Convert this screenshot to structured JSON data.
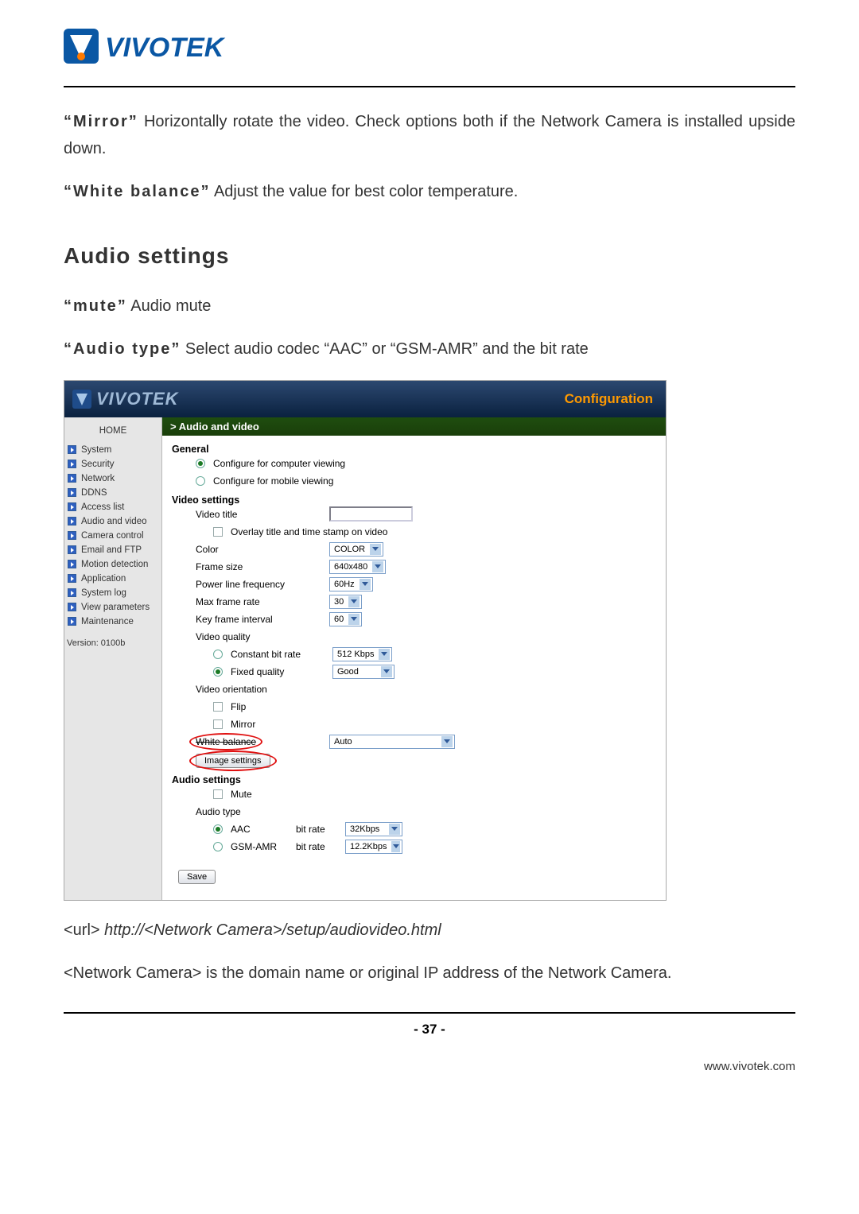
{
  "brand": "VIVOTEK",
  "body": {
    "mirror_label": "“Mirror”",
    "mirror_text": "Horizontally rotate the video. Check options both if the Network Camera is installed upside down.",
    "wb_label": "“White balance”",
    "wb_text": "Adjust the value for best color temperature.",
    "audio_heading": "Audio settings",
    "mute_label": "“mute”",
    "mute_text": "Audio mute",
    "atype_label": "“Audio type”",
    "atype_text": "Select audio codec “AAC” or “GSM-AMR” and the bit rate",
    "url_prefix": "<url>",
    "url_value": "http://<Network Camera>/setup/audiovideo.html",
    "note_text": "<Network Camera> is the domain name or original IP address of the Network Camera."
  },
  "cap": {
    "brand": "VIVOTEK",
    "config_label": "Configuration",
    "panel_title": "> Audio and video",
    "sidebar": {
      "home": "HOME",
      "items": [
        "System",
        "Security",
        "Network",
        "DDNS",
        "Access list",
        "Audio and video",
        "Camera control",
        "Email and FTP",
        "Motion detection",
        "Application",
        "System log",
        "View parameters",
        "Maintenance"
      ],
      "version": "Version: 0100b"
    },
    "groups": {
      "general": "General",
      "cfg_computer": "Configure for computer viewing",
      "cfg_mobile": "Configure for mobile viewing",
      "video_settings": "Video settings",
      "video_title": "Video title",
      "overlay": "Overlay title and time stamp on video",
      "color_label": "Color",
      "color_value": "COLOR",
      "frame_size_label": "Frame size",
      "frame_size_value": "640x480",
      "plf_label": "Power line frequency",
      "plf_value": "60Hz",
      "maxfr_label": "Max frame rate",
      "maxfr_value": "30",
      "kfi_label": "Key frame interval",
      "kfi_value": "60",
      "vq_label": "Video quality",
      "cbr_label": "Constant bit rate",
      "cbr_value": "512 Kbps",
      "fq_label": "Fixed quality",
      "fq_value": "Good",
      "vo_label": "Video orientation",
      "flip": "Flip",
      "mirror": "Mirror",
      "wb_label": "White balance",
      "wb_value": "Auto",
      "img_settings": "Image settings",
      "audio_settings": "Audio settings",
      "mute": "Mute",
      "audio_type": "Audio type",
      "aac": "AAC",
      "bitrate": "bit rate",
      "aac_bitrate": "32Kbps",
      "gsm": "GSM-AMR",
      "gsm_bitrate": "12.2Kbps",
      "save": "Save"
    }
  },
  "footer": {
    "page": "- 37 -",
    "url": "www.vivotek.com"
  }
}
